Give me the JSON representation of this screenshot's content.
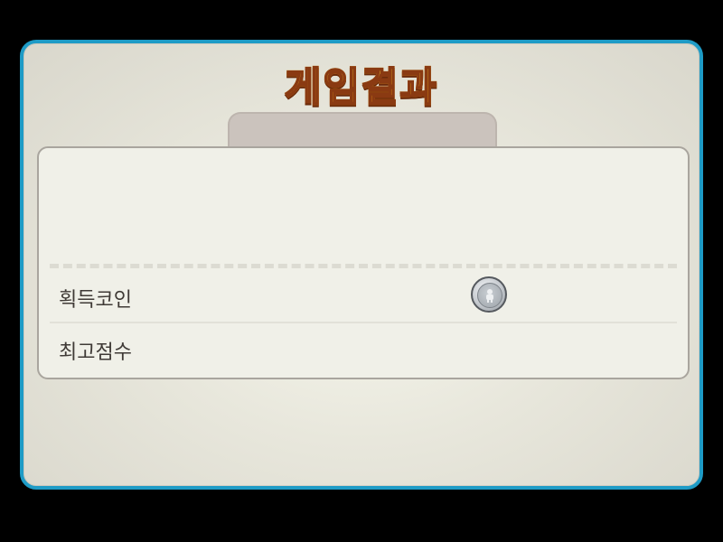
{
  "title": "게임결과",
  "rows": [
    {
      "label": "획득코인",
      "icon": "coin-icon"
    },
    {
      "label": "최고점수"
    }
  ],
  "colors": {
    "frame_border": "#1e9bc6",
    "title_fill": "#ffc21a",
    "title_outline": "#8a3a12",
    "panel_bg": "#f0f0e8",
    "tab_bg": "#cbc3bd"
  }
}
